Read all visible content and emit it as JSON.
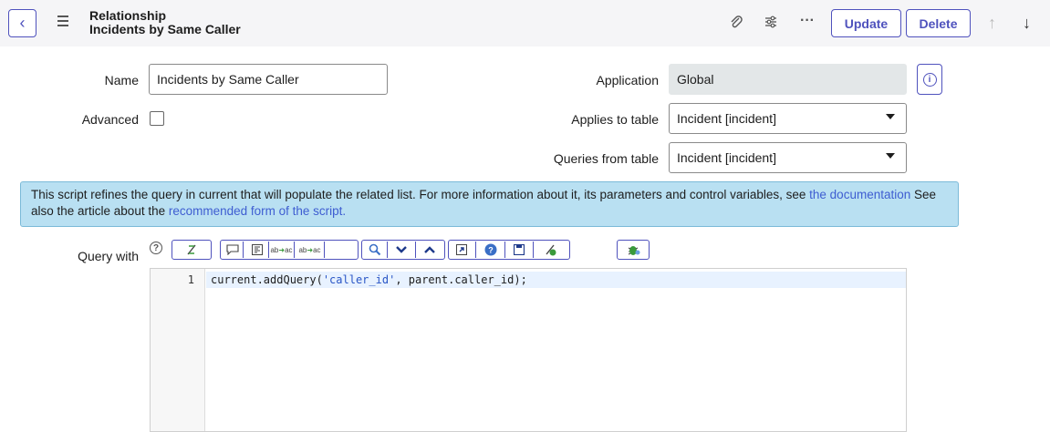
{
  "header": {
    "title_line1": "Relationship",
    "title_line2": "Incidents by Same Caller",
    "update_label": "Update",
    "delete_label": "Delete"
  },
  "form": {
    "name_label": "Name",
    "name_value": "Incidents by Same Caller",
    "advanced_label": "Advanced",
    "advanced_checked": false,
    "application_label": "Application",
    "application_value": "Global",
    "applies_to_label": "Applies to table",
    "applies_to_value": "Incident [incident]",
    "queries_from_label": "Queries from table",
    "queries_from_value": "Incident [incident]"
  },
  "banner": {
    "text1": "This script refines the query in current that will populate the related list. For more information about it, its parameters and control variables, see ",
    "link1": "the documentation",
    "text2": " See also the article about the ",
    "link2": "recommended form of the script."
  },
  "editor": {
    "label": "Query with",
    "line_number": "1",
    "code_prefix": "current.addQuery(",
    "code_str": "'caller_id'",
    "code_suffix": ", parent.caller_id);"
  },
  "colors": {
    "accent": "#4f52bd",
    "banner_bg": "#b9e0f2",
    "link": "#3e5dd1"
  }
}
